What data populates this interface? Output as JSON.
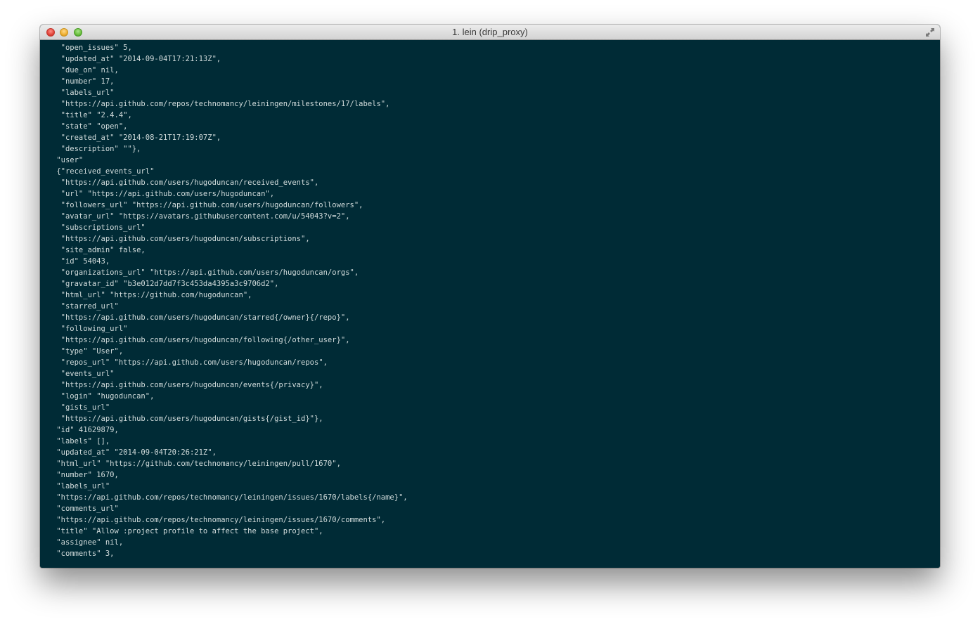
{
  "window": {
    "title": "1. lein (drip_proxy)"
  },
  "terminal": {
    "lines": [
      "  \"open_issues\" 5,",
      "  \"updated_at\" \"2014-09-04T17:21:13Z\",",
      "  \"due_on\" nil,",
      "  \"number\" 17,",
      "  \"labels_url\"",
      "  \"https://api.github.com/repos/technomancy/leiningen/milestones/17/labels\",",
      "  \"title\" \"2.4.4\",",
      "  \"state\" \"open\",",
      "  \"created_at\" \"2014-08-21T17:19:07Z\",",
      "  \"description\" \"\"},",
      " \"user\"",
      " {\"received_events_url\"",
      "  \"https://api.github.com/users/hugoduncan/received_events\",",
      "  \"url\" \"https://api.github.com/users/hugoduncan\",",
      "  \"followers_url\" \"https://api.github.com/users/hugoduncan/followers\",",
      "  \"avatar_url\" \"https://avatars.githubusercontent.com/u/54043?v=2\",",
      "  \"subscriptions_url\"",
      "  \"https://api.github.com/users/hugoduncan/subscriptions\",",
      "  \"site_admin\" false,",
      "  \"id\" 54043,",
      "  \"organizations_url\" \"https://api.github.com/users/hugoduncan/orgs\",",
      "  \"gravatar_id\" \"b3e012d7dd7f3c453da4395a3c9706d2\",",
      "  \"html_url\" \"https://github.com/hugoduncan\",",
      "  \"starred_url\"",
      "  \"https://api.github.com/users/hugoduncan/starred{/owner}{/repo}\",",
      "  \"following_url\"",
      "  \"https://api.github.com/users/hugoduncan/following{/other_user}\",",
      "  \"type\" \"User\",",
      "  \"repos_url\" \"https://api.github.com/users/hugoduncan/repos\",",
      "  \"events_url\"",
      "  \"https://api.github.com/users/hugoduncan/events{/privacy}\",",
      "  \"login\" \"hugoduncan\",",
      "  \"gists_url\"",
      "  \"https://api.github.com/users/hugoduncan/gists{/gist_id}\"},",
      " \"id\" 41629879,",
      " \"labels\" [],",
      " \"updated_at\" \"2014-09-04T20:26:21Z\",",
      " \"html_url\" \"https://github.com/technomancy/leiningen/pull/1670\",",
      " \"number\" 1670,",
      " \"labels_url\"",
      " \"https://api.github.com/repos/technomancy/leiningen/issues/1670/labels{/name}\",",
      " \"comments_url\"",
      " \"https://api.github.com/repos/technomancy/leiningen/issues/1670/comments\",",
      " \"title\" \"Allow :project profile to affect the base project\",",
      " \"assignee\" nil,",
      " \"comments\" 3,"
    ]
  },
  "icons": {
    "close": "close-button",
    "minimize": "minimize-button",
    "zoom": "zoom-button",
    "fullscreen": "fullscreen-icon"
  },
  "colors": {
    "terminal_background": "#002b36",
    "terminal_text": "#d2dcdc"
  }
}
